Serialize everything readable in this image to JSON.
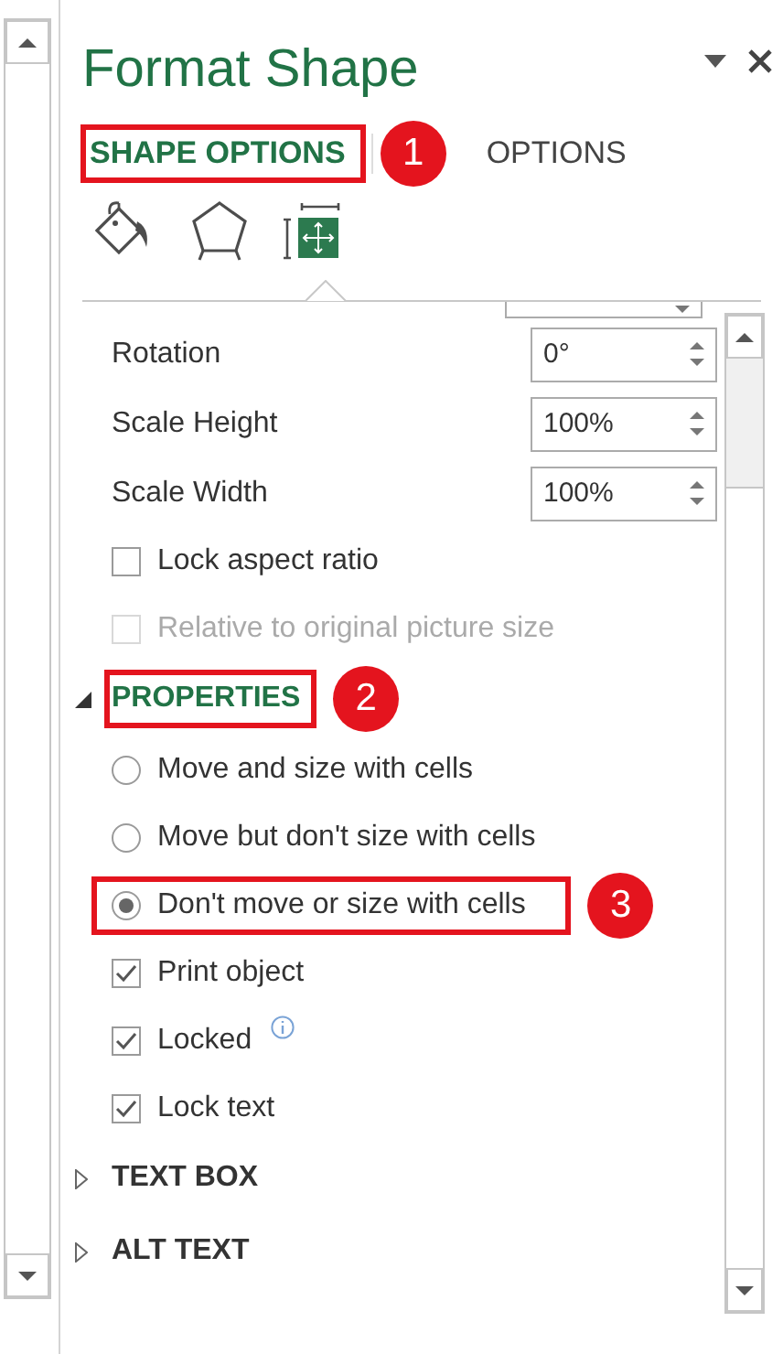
{
  "title": "Format Shape",
  "tabs": [
    {
      "label": "SHAPE OPTIONS",
      "selected": true,
      "callout": "1"
    },
    {
      "label": "OPTIONS",
      "selected": false
    }
  ],
  "category_icons": [
    {
      "kind": "fill",
      "selected": false
    },
    {
      "kind": "shape",
      "selected": false
    },
    {
      "kind": "size",
      "selected": true
    }
  ],
  "size_fields": [
    {
      "label": "Rotation",
      "value": "0°"
    },
    {
      "label": "Scale Height",
      "value": "100%"
    },
    {
      "label": "Scale Width",
      "value": "100%"
    }
  ],
  "size_checks": [
    {
      "label": "Lock aspect ratio",
      "checked": false,
      "disabled": false
    },
    {
      "label": "Relative to original picture size",
      "checked": false,
      "disabled": true
    }
  ],
  "sections": [
    {
      "title": "PROPERTIES",
      "expanded": true,
      "callout": "2",
      "items": [
        {
          "kind": "radio",
          "label": "Move and size with cells",
          "selected": false,
          "info": false
        },
        {
          "kind": "radio",
          "label": "Move but don't size with cells",
          "selected": false,
          "info": false
        },
        {
          "kind": "radio",
          "label": "Don't move or size with cells",
          "selected": true,
          "info": false,
          "callout": "3"
        },
        {
          "kind": "checkbox",
          "label": "Print object",
          "checked": true,
          "info": false
        },
        {
          "kind": "checkbox",
          "label": "Locked",
          "checked": true,
          "info": true
        },
        {
          "kind": "checkbox",
          "label": "Lock text",
          "checked": true,
          "info": false
        }
      ]
    },
    {
      "title": "TEXT BOX",
      "expanded": false
    },
    {
      "title": "ALT TEXT",
      "expanded": false
    }
  ]
}
